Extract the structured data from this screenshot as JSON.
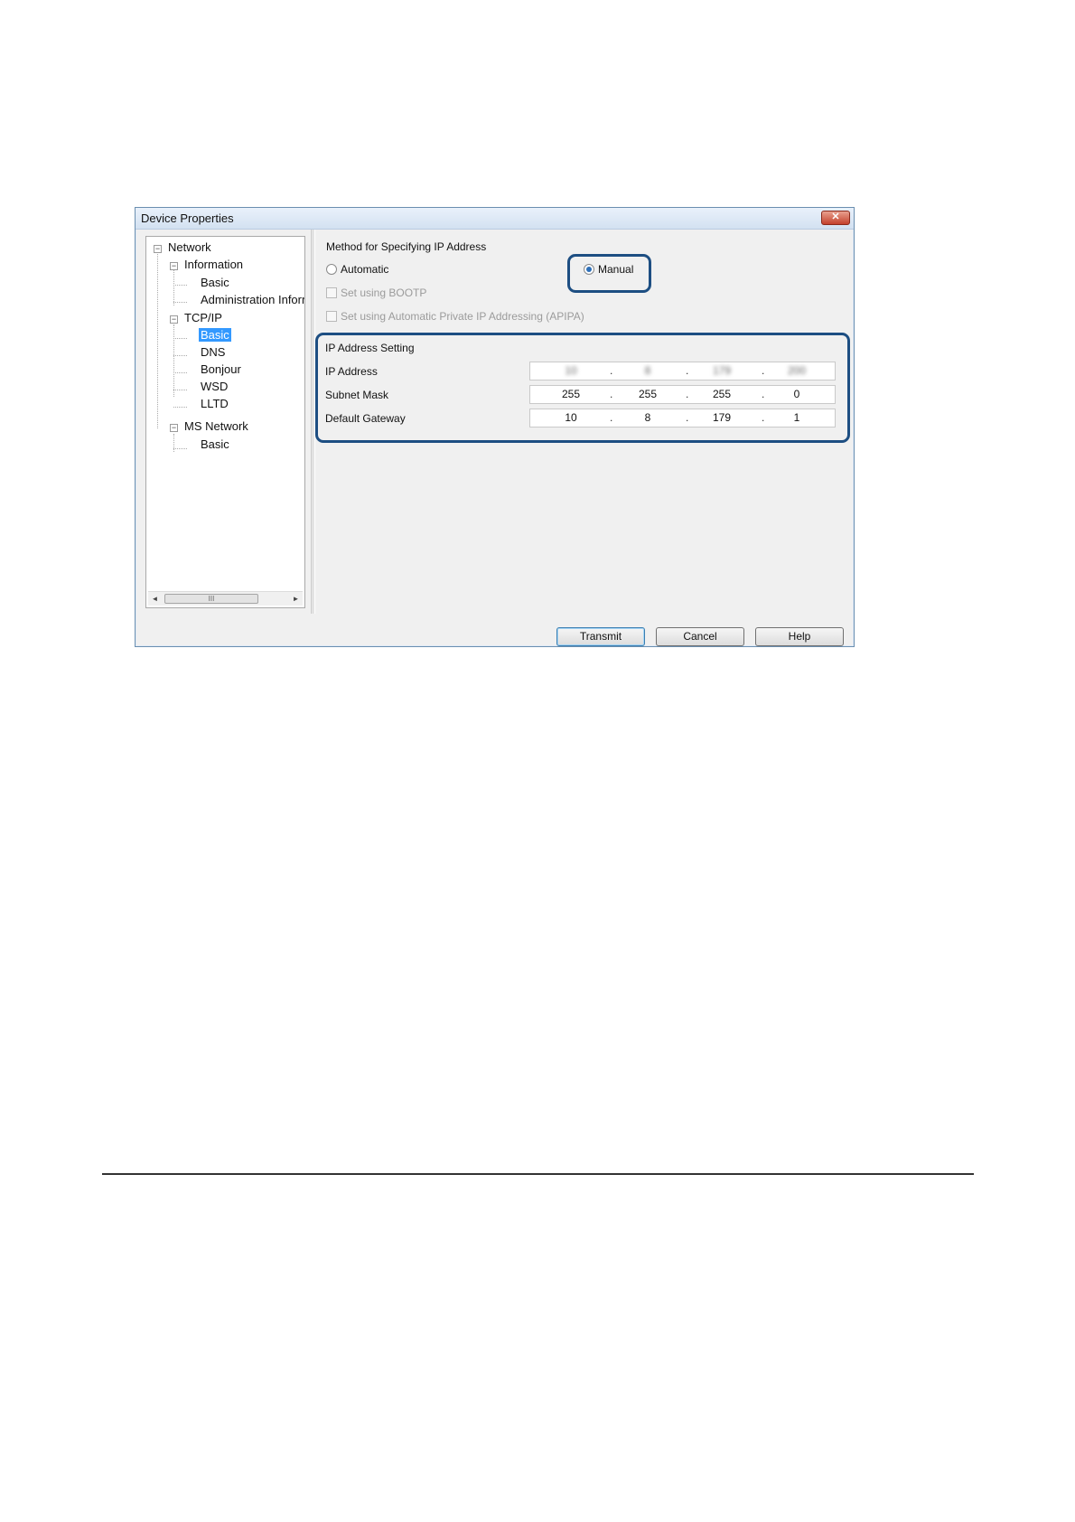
{
  "window": {
    "title": "Device Properties",
    "close_glyph": "✕"
  },
  "tree": {
    "items": [
      {
        "label": "Network",
        "toggle": "−"
      },
      {
        "label": "Information",
        "toggle": "−"
      },
      {
        "label": "Basic"
      },
      {
        "label": "Administration Information"
      },
      {
        "label": "TCP/IP",
        "toggle": "−"
      },
      {
        "label": "Basic",
        "selected": true
      },
      {
        "label": "DNS"
      },
      {
        "label": "Bonjour"
      },
      {
        "label": "WSD"
      },
      {
        "label": "LLTD"
      },
      {
        "label": "MS Network",
        "toggle": "−"
      },
      {
        "label": "Basic"
      }
    ],
    "scroll": {
      "left": "◄",
      "right": "►",
      "thumb": "III"
    }
  },
  "method": {
    "label": "Method for Specifying IP Address",
    "automatic": "Automatic",
    "manual": "Manual",
    "selected": "manual",
    "bootp": "Set using BOOTP",
    "apipa": "Set using Automatic Private IP Addressing (APIPA)"
  },
  "ip_setting": {
    "label": "IP Address Setting",
    "rows": [
      {
        "label": "IP Address",
        "octets": [
          "10",
          "8",
          "179",
          "200"
        ],
        "blurred": true
      },
      {
        "label": "Subnet Mask",
        "octets": [
          "255",
          "255",
          "255",
          "0"
        ]
      },
      {
        "label": "Default Gateway",
        "octets": [
          "10",
          "8",
          "179",
          "1"
        ]
      }
    ],
    "separator": "."
  },
  "buttons": {
    "transmit": "Transmit",
    "cancel": "Cancel",
    "help": "Help"
  },
  "colors": {
    "highlight": "#1d4e82",
    "selection": "#3399ff"
  }
}
